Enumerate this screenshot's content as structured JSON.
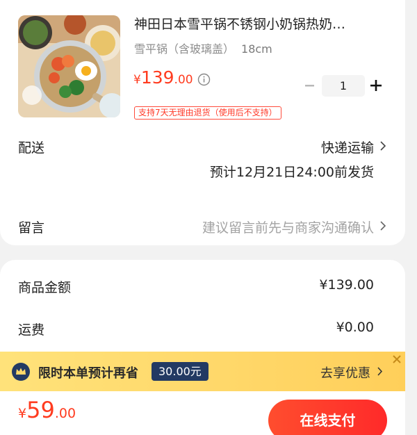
{
  "product": {
    "title": "神田日本雪平锅不锈钢小奶锅热奶…",
    "spec_name": "雪平锅（含玻璃盖）",
    "spec_size": "18cm",
    "price_symbol": "¥",
    "price_int": "139",
    "price_dec": ".00",
    "quantity": "1",
    "badge": "支持7天无理由退货（使用后不支持）"
  },
  "delivery": {
    "label": "配送",
    "method": "快递运输",
    "eta": "预计12月21日24:00前发货"
  },
  "message": {
    "label": "留言",
    "placeholder": "建议留言前先与商家沟通确认"
  },
  "summary": {
    "goods_label": "商品金额",
    "goods_value": "¥139.00",
    "shipping_label": "运费",
    "shipping_value": "¥0.00"
  },
  "promo": {
    "text": "限时本单预计再省",
    "amount": "30.00元",
    "cta": "去享优惠"
  },
  "footer": {
    "total_symbol": "¥",
    "total_int": "59",
    "total_dec": ".00",
    "pay_label": "在线支付"
  },
  "colors": {
    "accent": "#ff3b1f",
    "promo_bg": "#ffd86a",
    "promo_badge": "#233a63"
  },
  "icons": [
    "info-icon",
    "minus-icon",
    "plus-icon",
    "chevron-right-icon",
    "close-icon",
    "crown-logo-icon"
  ]
}
